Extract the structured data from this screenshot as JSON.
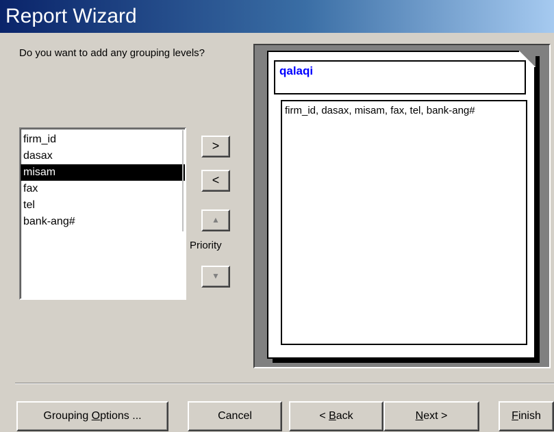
{
  "window": {
    "title": "Report Wizard"
  },
  "prompt": {
    "question": "Do you want to add any grouping levels?"
  },
  "fields": {
    "items": [
      "firm_id",
      "dasax",
      "misam",
      "fax",
      "tel",
      "bank-ang#"
    ],
    "selected": "misam"
  },
  "buttons": {
    "add_label": ">",
    "remove_label": "<",
    "priority_up_glyph": "▲",
    "priority_down_glyph": "▼",
    "priority_label": "Priority"
  },
  "preview": {
    "group_title": "qalaqi",
    "detail_text": "firm_id, dasax, misam, fax, tel, bank-ang#"
  },
  "footer": {
    "grouping_options_pre": "Grouping ",
    "grouping_options_mnemonic": "O",
    "grouping_options_post": "ptions ...",
    "cancel": "Cancel",
    "back_pre": "< ",
    "back_mnemonic": "B",
    "back_post": "ack",
    "next_mnemonic": "N",
    "next_post": "ext >",
    "finish_mnemonic": "F",
    "finish_post": "inish"
  }
}
